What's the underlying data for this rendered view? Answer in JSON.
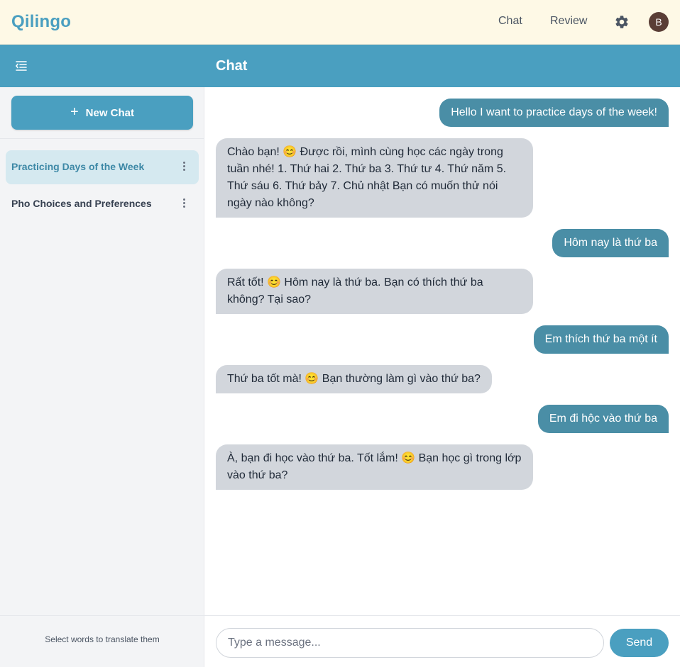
{
  "app": {
    "logo": "Qilingo",
    "nav": {
      "chat": "Chat",
      "review": "Review"
    },
    "avatar_initial": "B",
    "accent": "#4a9fc0"
  },
  "header": {
    "title": "Chat",
    "toggle_icon": "sidebar-toggle-icon"
  },
  "sidebar": {
    "new_chat_label": "New Chat",
    "conversations": [
      {
        "label": "Practicing Days of the Week",
        "active": true
      },
      {
        "label": "Pho Choices and Preferences",
        "active": false
      }
    ],
    "hint": "Select words to translate them"
  },
  "messages": [
    {
      "role": "user",
      "text": "Hello I want to practice days of the week!"
    },
    {
      "role": "bot",
      "text": "Chào bạn! 😊 Được rồi, mình cùng học các ngày trong tuần nhé! 1. Thứ hai 2. Thứ ba 3. Thứ tư 4. Thứ năm 5. Thứ sáu 6. Thứ bảy 7. Chủ nhật Bạn có muốn thử nói ngày nào không?"
    },
    {
      "role": "user",
      "text": "Hôm nay là thứ ba"
    },
    {
      "role": "bot",
      "text": "Rất tốt! 😊 Hôm nay là thứ ba. Bạn có thích thứ ba không? Tại sao?"
    },
    {
      "role": "user",
      "text": "Em thích thứ ba một ít"
    },
    {
      "role": "bot",
      "text": "Thứ ba tốt mà! 😊 Bạn thường làm gì vào thứ ba?"
    },
    {
      "role": "user",
      "text": "Em đi hộc vào thứ ba"
    },
    {
      "role": "bot",
      "text": "À, bạn đi học vào thứ ba. Tốt lắm! 😊 Bạn học gì trong lớp vào thứ ba?"
    }
  ],
  "composer": {
    "placeholder": "Type a message...",
    "value": "",
    "send_label": "Send"
  }
}
